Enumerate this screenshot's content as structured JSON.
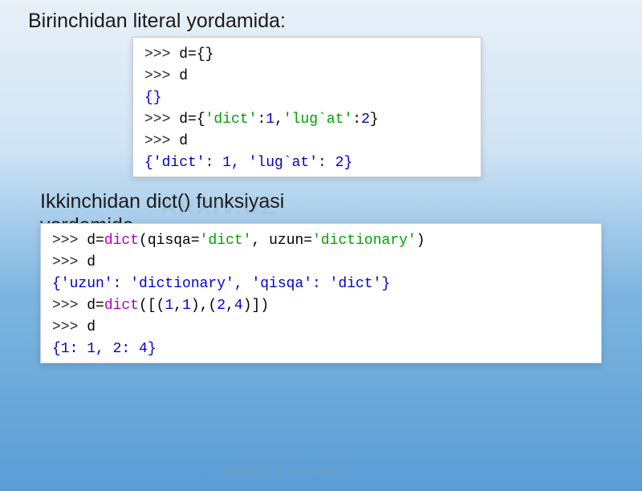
{
  "watermark": "ARXIV.UZ",
  "headings": {
    "h1": "Birinchidan literal yordamida:",
    "h2a": "Ikkinchidan dict() funksiyasi",
    "h2b": "yordamida"
  },
  "code1": {
    "lines": [
      {
        "parts": [
          {
            "cls": "prompt",
            "t": ">>> "
          },
          {
            "cls": "plain",
            "t": "d={}"
          }
        ]
      },
      {
        "parts": [
          {
            "cls": "prompt",
            "t": ">>> "
          },
          {
            "cls": "plain",
            "t": "d"
          }
        ]
      },
      {
        "parts": [
          {
            "cls": "out-blue",
            "t": "{}"
          }
        ]
      },
      {
        "parts": [
          {
            "cls": "prompt",
            "t": ">>> "
          },
          {
            "cls": "plain",
            "t": "d={"
          },
          {
            "cls": "str",
            "t": "'dict'"
          },
          {
            "cls": "plain",
            "t": ":"
          },
          {
            "cls": "num",
            "t": "1"
          },
          {
            "cls": "plain",
            "t": ","
          },
          {
            "cls": "str",
            "t": "'lug`at'"
          },
          {
            "cls": "plain",
            "t": ":"
          },
          {
            "cls": "num",
            "t": "2"
          },
          {
            "cls": "plain",
            "t": "}"
          }
        ]
      },
      {
        "parts": [
          {
            "cls": "prompt",
            "t": ">>> "
          },
          {
            "cls": "plain",
            "t": "d"
          }
        ]
      },
      {
        "parts": [
          {
            "cls": "out-blue",
            "t": "{'dict': 1, 'lug`at': 2}"
          }
        ]
      }
    ]
  },
  "code2": {
    "lines": [
      {
        "parts": [
          {
            "cls": "prompt",
            "t": ">>> "
          },
          {
            "cls": "plain",
            "t": "d="
          },
          {
            "cls": "kw",
            "t": "dict"
          },
          {
            "cls": "plain",
            "t": "(qisqa="
          },
          {
            "cls": "str",
            "t": "'dict'"
          },
          {
            "cls": "plain",
            "t": ", uzun="
          },
          {
            "cls": "str",
            "t": "'dictionary'"
          },
          {
            "cls": "plain",
            "t": ")"
          }
        ]
      },
      {
        "parts": [
          {
            "cls": "prompt",
            "t": ">>> "
          },
          {
            "cls": "plain",
            "t": "d"
          }
        ]
      },
      {
        "parts": [
          {
            "cls": "out-blue",
            "t": "{'uzun': 'dictionary', 'qisqa': 'dict'}"
          }
        ]
      },
      {
        "parts": [
          {
            "cls": "prompt",
            "t": ">>> "
          },
          {
            "cls": "plain",
            "t": "d="
          },
          {
            "cls": "kw",
            "t": "dict"
          },
          {
            "cls": "plain",
            "t": "([("
          },
          {
            "cls": "num",
            "t": "1"
          },
          {
            "cls": "plain",
            "t": ","
          },
          {
            "cls": "num",
            "t": "1"
          },
          {
            "cls": "plain",
            "t": "),("
          },
          {
            "cls": "num",
            "t": "2"
          },
          {
            "cls": "plain",
            "t": ","
          },
          {
            "cls": "num",
            "t": "4"
          },
          {
            "cls": "plain",
            "t": ")])"
          }
        ]
      },
      {
        "parts": [
          {
            "cls": "prompt",
            "t": ">>> "
          },
          {
            "cls": "plain",
            "t": "d"
          }
        ]
      },
      {
        "parts": [
          {
            "cls": "out-blue",
            "t": "{1: 1, 2: 4}"
          }
        ]
      }
    ]
  }
}
